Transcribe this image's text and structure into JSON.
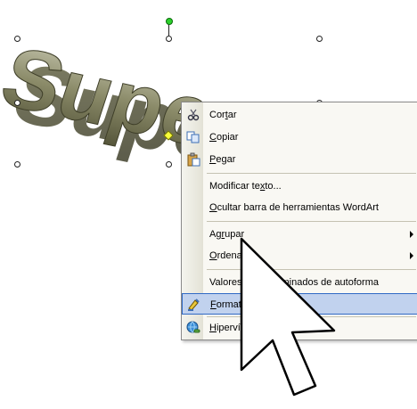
{
  "wordart": {
    "text": "Supermark",
    "colors": {
      "face": "#7b7b5a",
      "shadow": "#4e4e34",
      "highlight": "#c6c6b0"
    }
  },
  "menu": {
    "items": [
      {
        "id": "cortar",
        "icon": "scissors-icon",
        "parts": [
          "Cor",
          "t",
          "ar"
        ]
      },
      {
        "id": "copiar",
        "icon": "copy-icon",
        "parts": [
          "",
          "C",
          "opiar"
        ]
      },
      {
        "id": "pegar",
        "icon": "paste-icon",
        "parts": [
          "",
          "P",
          "egar"
        ]
      },
      {
        "id": "modificar",
        "icon": "",
        "parts": [
          "Modificar te",
          "x",
          "to..."
        ]
      },
      {
        "id": "ocultar",
        "icon": "",
        "parts": [
          "",
          "O",
          "cultar barra de herramientas WordArt"
        ]
      },
      {
        "id": "agrupar",
        "icon": "",
        "parts": [
          "Ag",
          "r",
          "upar"
        ],
        "submenu": true
      },
      {
        "id": "ordenar",
        "icon": "",
        "parts": [
          "",
          "O",
          "rdenar"
        ],
        "submenu": true
      },
      {
        "id": "valores",
        "icon": "",
        "parts": [
          "Valores pre",
          "d",
          "eterminados de autoforma"
        ]
      },
      {
        "id": "formato",
        "icon": "format-wordart-icon",
        "parts": [
          "",
          "F",
          "ormato de WordArt..."
        ],
        "highlight": true
      },
      {
        "id": "hipervinculo",
        "icon": "hyperlink-icon",
        "parts": [
          "",
          "H",
          "ipervínculo..."
        ]
      }
    ]
  },
  "colors": {
    "menu_highlight": "#c1d2ee",
    "menu_highlight_border": "#316ac5"
  }
}
